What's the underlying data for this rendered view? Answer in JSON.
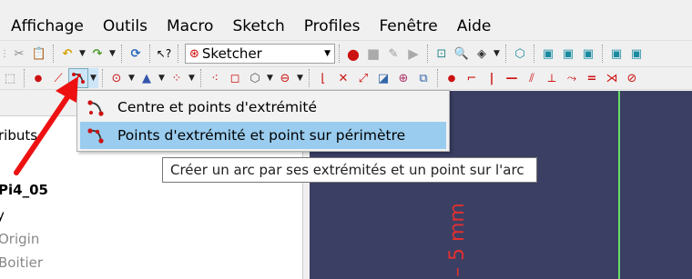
{
  "menubar": {
    "items": [
      "Affichage",
      "Outils",
      "Macro",
      "Sketch",
      "Profiles",
      "Fenêtre",
      "Aide"
    ]
  },
  "toolbar": {
    "workbench_label": "Sketcher"
  },
  "dropdown": {
    "items": [
      {
        "label": "Centre et points d'extrémité",
        "selected": false
      },
      {
        "label": "Points d'extrémité et point sur périmètre",
        "selected": true
      }
    ]
  },
  "tooltip": {
    "text": "Créer un arc par ses extrémités et un point sur l'arc"
  },
  "tree": {
    "items": [
      "ributs",
      "Pi4_05",
      "y",
      "Origin",
      "Boitier"
    ]
  },
  "viewport": {
    "dimension_text": "5 mm"
  },
  "colors": {
    "viewport_bg": "#3b3f63",
    "selection": "#99ccee",
    "axis_green": "#66dd66",
    "dimension_red": "#e03030",
    "annotation_arrow": "#ee1111"
  },
  "icons": {
    "arc_dropdown": "arc-three-points-icon",
    "arc_center": "arc-center-icon",
    "arc_3points": "arc-three-points-icon"
  }
}
